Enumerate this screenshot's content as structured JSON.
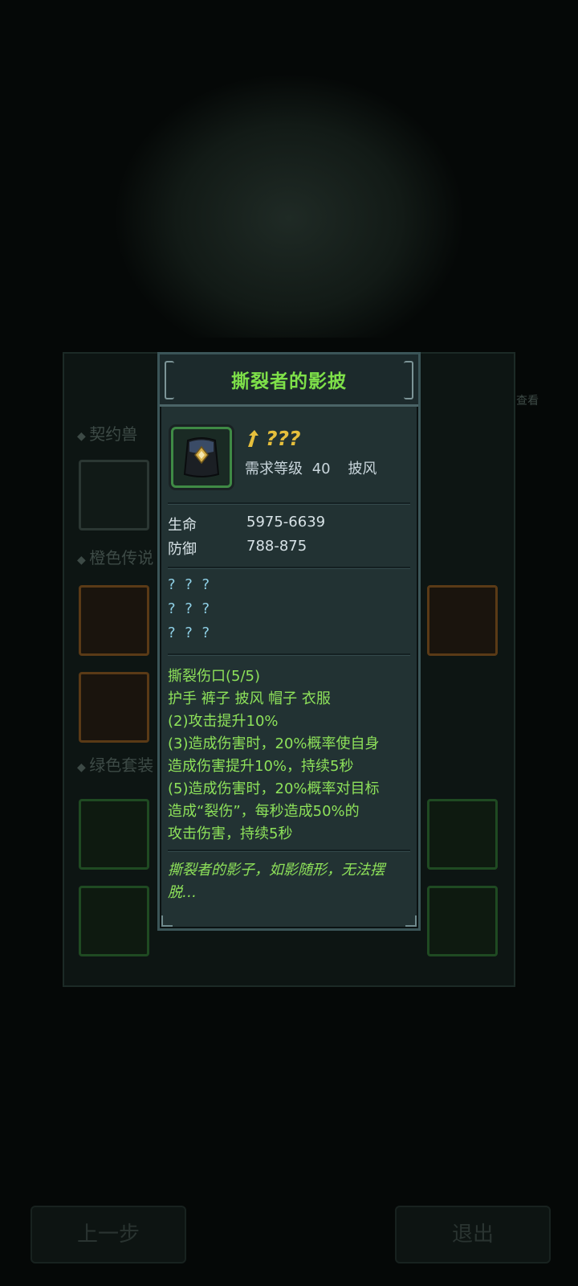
{
  "background": {
    "sections": [
      "契约兽",
      "橙色传说",
      "绿色套装"
    ],
    "side_label": "查看",
    "buttons": {
      "prev": "上一步",
      "exit": "退出"
    }
  },
  "item": {
    "name": "撕裂者的影披",
    "rank": "???",
    "requirement": {
      "label": "需求等级",
      "level": "40",
      "slot": "披风"
    },
    "stats": [
      {
        "label": "生命",
        "value": "5975-6639"
      },
      {
        "label": "防御",
        "value": "788-875"
      }
    ],
    "unknown_affixes": [
      "? ? ?",
      "? ? ?",
      "? ? ?"
    ],
    "set": {
      "name": "撕裂伤口(5/5)",
      "pieces": "护手 裤子 披风 帽子 衣服",
      "bonus_lines": [
        "(2)攻击提升10%",
        "(3)造成伤害时，20%概率使自身",
        "造成伤害提升10%，持续5秒",
        "(5)造成伤害时，20%概率对目标",
        "造成“裂伤”，每秒造成50%的",
        "攻击伤害，持续5秒"
      ]
    },
    "flavor": "撕裂者的影子，如影随形，无法摆脱…"
  },
  "colors": {
    "title_green": "#7ee049",
    "rank_gold": "#e6bf3c",
    "unknown_blue": "#8fd0e6",
    "set_green": "#8ee25a"
  }
}
